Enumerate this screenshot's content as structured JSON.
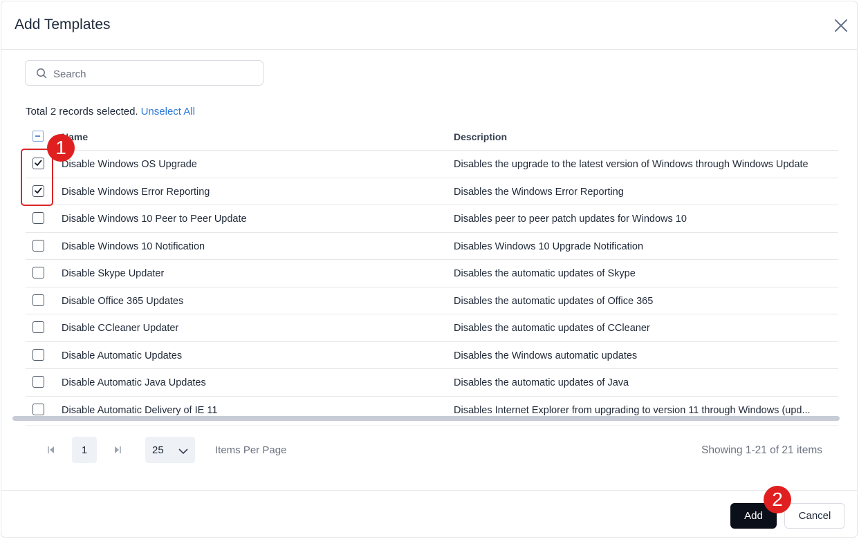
{
  "dialog": {
    "title": "Add Templates"
  },
  "search": {
    "placeholder": "Search",
    "value": ""
  },
  "selection": {
    "text": "Total 2 records selected.",
    "unselect_label": "Unselect All"
  },
  "table": {
    "columns": [
      "Name",
      "Description"
    ],
    "rows": [
      {
        "checked": true,
        "name": "Disable Windows OS Upgrade",
        "description": "Disables the upgrade to the latest version of Windows through Windows Update"
      },
      {
        "checked": true,
        "name": "Disable Windows Error Reporting",
        "description": "Disables the Windows Error Reporting"
      },
      {
        "checked": false,
        "name": "Disable Windows 10 Peer to Peer Update",
        "description": "Disables peer to peer patch updates for Windows 10"
      },
      {
        "checked": false,
        "name": "Disable Windows 10 Notification",
        "description": "Disables Windows 10 Upgrade Notification"
      },
      {
        "checked": false,
        "name": "Disable Skype Updater",
        "description": "Disables the automatic updates of Skype"
      },
      {
        "checked": false,
        "name": "Disable Office 365 Updates",
        "description": "Disables the automatic updates of Office 365"
      },
      {
        "checked": false,
        "name": "Disable CCleaner Updater",
        "description": "Disables the automatic updates of CCleaner"
      },
      {
        "checked": false,
        "name": "Disable Automatic Updates",
        "description": "Disables the Windows automatic updates"
      },
      {
        "checked": false,
        "name": "Disable Automatic Java Updates",
        "description": "Disables the automatic updates of Java"
      },
      {
        "checked": false,
        "name": "Disable Automatic Delivery of IE 11",
        "description": "Disables Internet Explorer from upgrading to version 11 through Windows (upd..."
      }
    ]
  },
  "pagination": {
    "current_page": "1",
    "per_page": "25",
    "per_page_label": "Items Per Page",
    "showing": "Showing 1-21 of 21 items"
  },
  "footer": {
    "add_label": "Add",
    "cancel_label": "Cancel"
  },
  "annotations": {
    "badge_1": "1",
    "badge_2": "2",
    "color": "#e02020"
  },
  "colors": {
    "primary_button": "#0b0f19",
    "link": "#2f7bd8"
  }
}
